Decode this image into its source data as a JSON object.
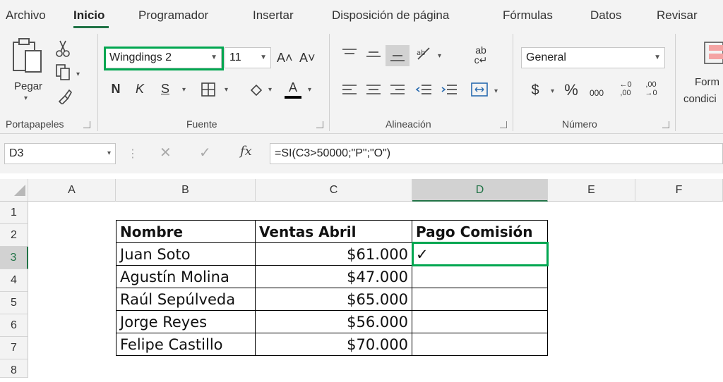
{
  "tabs": [
    "Archivo",
    "Inicio",
    "Programador",
    "Insertar",
    "Disposición de página",
    "Fórmulas",
    "Datos",
    "Revisar"
  ],
  "clipboard": {
    "paste_label": "Pegar",
    "group_label": "Portapapeles"
  },
  "font": {
    "name": "Wingdings 2",
    "size": "11",
    "bold": "N",
    "italic": "K",
    "underline": "S",
    "group_label": "Fuente"
  },
  "alignment": {
    "group_label": "Alineación"
  },
  "number": {
    "format": "General",
    "currency": "$",
    "percent": "%",
    "thousands": "000",
    "group_label": "Número"
  },
  "styles": {
    "cond_format_label_1": "Form",
    "cond_format_label_2": "condici"
  },
  "formula_bar": {
    "name_box": "D3",
    "fx": "fx",
    "formula": "=SI(C3>50000;\"P\";\"O\")"
  },
  "sheet": {
    "columns": [
      "A",
      "B",
      "C",
      "D",
      "E",
      "F"
    ],
    "rows": [
      "1",
      "2",
      "3",
      "4",
      "5",
      "6",
      "7",
      "8"
    ],
    "table": {
      "headers": [
        "Nombre",
        "Ventas Abril",
        "Pago Comisión"
      ],
      "rows": [
        [
          "Juan Soto",
          "$61.000",
          "✓"
        ],
        [
          "Agustín Molina",
          "$47.000",
          ""
        ],
        [
          "Raúl Sepúlveda",
          "$65.000",
          ""
        ],
        [
          "Jorge Reyes",
          "$56.000",
          ""
        ],
        [
          "Felipe Castillo",
          "$70.000",
          ""
        ]
      ]
    }
  },
  "colors": {
    "accent": "#217346",
    "highlight": "#00a650"
  }
}
